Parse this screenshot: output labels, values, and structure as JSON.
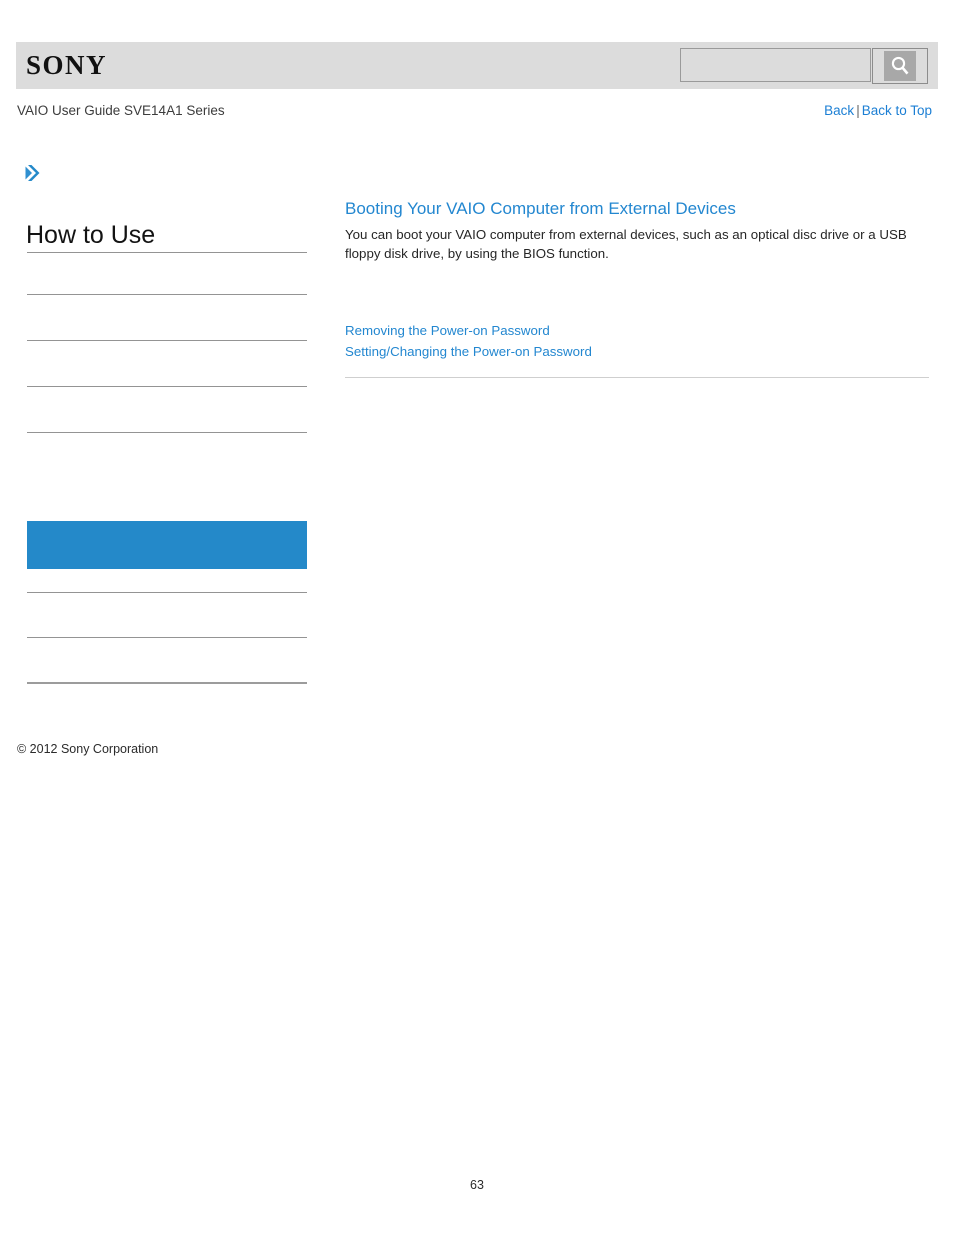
{
  "header": {
    "logo_text": "SONY",
    "search": {
      "value": "",
      "placeholder": "",
      "button_icon": "search-icon"
    }
  },
  "breadcrumb": {
    "guide_title": "VAIO User Guide SVE14A1 Series",
    "back_label": "Back",
    "separator": "|",
    "back_to_top_label": "Back to Top"
  },
  "sidebar": {
    "expand_icon": "double-chevron-right-icon",
    "section_title": "How to Use",
    "items": [
      {
        "label": "",
        "selected": false
      },
      {
        "label": "",
        "selected": false
      },
      {
        "label": "",
        "selected": false
      },
      {
        "label": "",
        "selected": false
      },
      {
        "label": "",
        "selected": true
      },
      {
        "label": "",
        "selected": false
      },
      {
        "label": "",
        "selected": false
      }
    ],
    "copyright": "© 2012 Sony Corporation"
  },
  "main": {
    "heading": "Booting Your VAIO Computer from External Devices",
    "body": "You can boot your VAIO computer from external devices, such as an optical disc drive or a USB floppy disk drive, by using the BIOS function.",
    "related_links": [
      "Removing the Power-on Password",
      "Setting/Changing the Power-on Password"
    ]
  },
  "footer": {
    "page_number": "63"
  },
  "colors": {
    "accent_blue": "#2387d0",
    "selected_blue": "#2489c9",
    "header_gray": "#dcdcdc",
    "rule_gray": "#949494"
  }
}
